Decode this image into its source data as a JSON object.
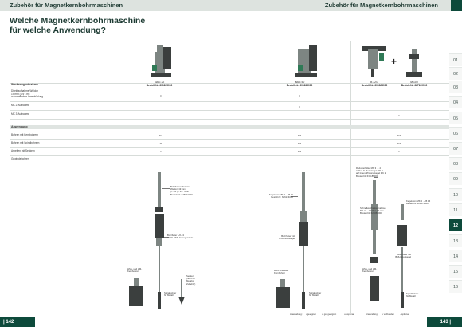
{
  "header": {
    "left_title": "Zubehör für Magnetkernbohrmaschinen",
    "right_title": "Zubehör für Magnetkernbohrmaschinen"
  },
  "page_title": {
    "line1": "Welche Magnetkernbohrmaschine",
    "line2": "für welche Anwendung?"
  },
  "products": [
    {
      "name": "MAG 32",
      "order": "Bestell-Nr. 600635000"
    },
    {
      "name": "MAG 50",
      "order": "Bestell-Nr. 600636000"
    },
    {
      "name": "B 32/3",
      "order": "Bestell-Nr. 600323000"
    },
    {
      "name": "M 100",
      "order": "Bestell-Nr. 627100000"
    }
  ],
  "table": {
    "section1": {
      "header": "Werkzeugaufnahme",
      "rows": [
        {
          "label_l1": "Direktaufnahme Weldon",
          "label_l2": "19 mm (3/4\") mit",
          "label_l3": "automatischer Innenkühlung",
          "c1": "•",
          "c2": "•",
          "c3": ""
        },
        {
          "label_l1": "MK 2-Aufnahme",
          "label_l2": "",
          "label_l3": "",
          "c1": "",
          "c2": "•",
          "c3": ""
        },
        {
          "label_l1": "MK 3-Aufnahme",
          "label_l2": "",
          "label_l3": "",
          "c1": "",
          "c2": "",
          "c3": "•"
        }
      ]
    },
    "section2": {
      "header": "Anwendung",
      "rows": [
        {
          "label": "Bohren mit Kernbohrern",
          "c1": "•••",
          "c2": "•••",
          "c3": "•••"
        },
        {
          "label": "Bohren mit Spiralbohrern",
          "c1": "••",
          "c2": "•••",
          "c3": "•••"
        },
        {
          "label": "Arbeiten mit Senkern",
          "c1": "•",
          "c2": "•••",
          "c3": "•"
        },
        {
          "label": "Gewindebohren",
          "c1": "-",
          "c2": "-",
          "c3": "-"
        }
      ]
    }
  },
  "col1_notes": {
    "adapter": [
      "Bohrfutteraufnahme",
      "Weldon 19 mm",
      "(= 3/4\") - 1/2\" UNF",
      "Bestell-Nr. 626671000"
    ],
    "chuck": [
      "Bohrfutter 1/2-13",
      "x 1/2\" UNF, Innengewinde"
    ],
    "core": [
      "HSS- und HM-",
      "Kernbohrer"
    ],
    "spiral": [
      "Spiralbohrer",
      "für Metall"
    ],
    "sink": [
      "Senker",
      "(nicht im",
      "Metabo",
      "Zubehör)"
    ]
  },
  "col2_notes": {
    "adapter": [
      "Kegeldorn MK 2 → B 16",
      "Bestell-Nr. 626174000"
    ],
    "chuck": [
      "Bohrfutter mit",
      "B16-Innenkegel"
    ],
    "core": [
      "HSS- und HM-",
      "Kernbohrer"
    ],
    "spiral": [
      "Spiralbohrer",
      "für Metall"
    ]
  },
  "col3_notes": {
    "adapter": [
      "Reduzierhülse MK 3 → 2",
      "Außen-S Morsekegel MK 3",
      "auf Innen-Ø Morsekegel MK 2",
      "Bestell-Nr. 631185000"
    ],
    "weldon": [
      "Schnellwechselaufnahme",
      "MK 2 → Weldon 19 mm",
      "Bestell-Nr. 626663000"
    ],
    "kegel": [
      "Kegeldorn MK 2 → B 16",
      "Bestell-Nr. 626174000"
    ],
    "chuck": [
      "Bohrfutter mit",
      "B16-Innenkegel"
    ],
    "core": [
      "HSS- und HM-",
      "Kernbohrer"
    ],
    "spiral": [
      "Spiralbohrer",
      "für Metall"
    ]
  },
  "side_tabs": [
    "01",
    "02",
    "03",
    "04",
    "05",
    "06",
    "07",
    "08",
    "09",
    "10",
    "11",
    "12",
    "13",
    "14",
    "15",
    "16"
  ],
  "active_tab": "12",
  "legend": {
    "title": "Anwendung:",
    "l1": "• geeignet",
    "l2": "•• gut geeignet",
    "l3": "••• optimal",
    "title2": "Anwendung:",
    "l4": "• vorhanden",
    "l5": "- optional"
  },
  "footer": {
    "left_page": "| 142",
    "right_page": "143 |"
  },
  "colors": {
    "brand_green": "#0d4a3b",
    "header_bg": "#dde3df",
    "section_bg": "#dfe4e1"
  }
}
